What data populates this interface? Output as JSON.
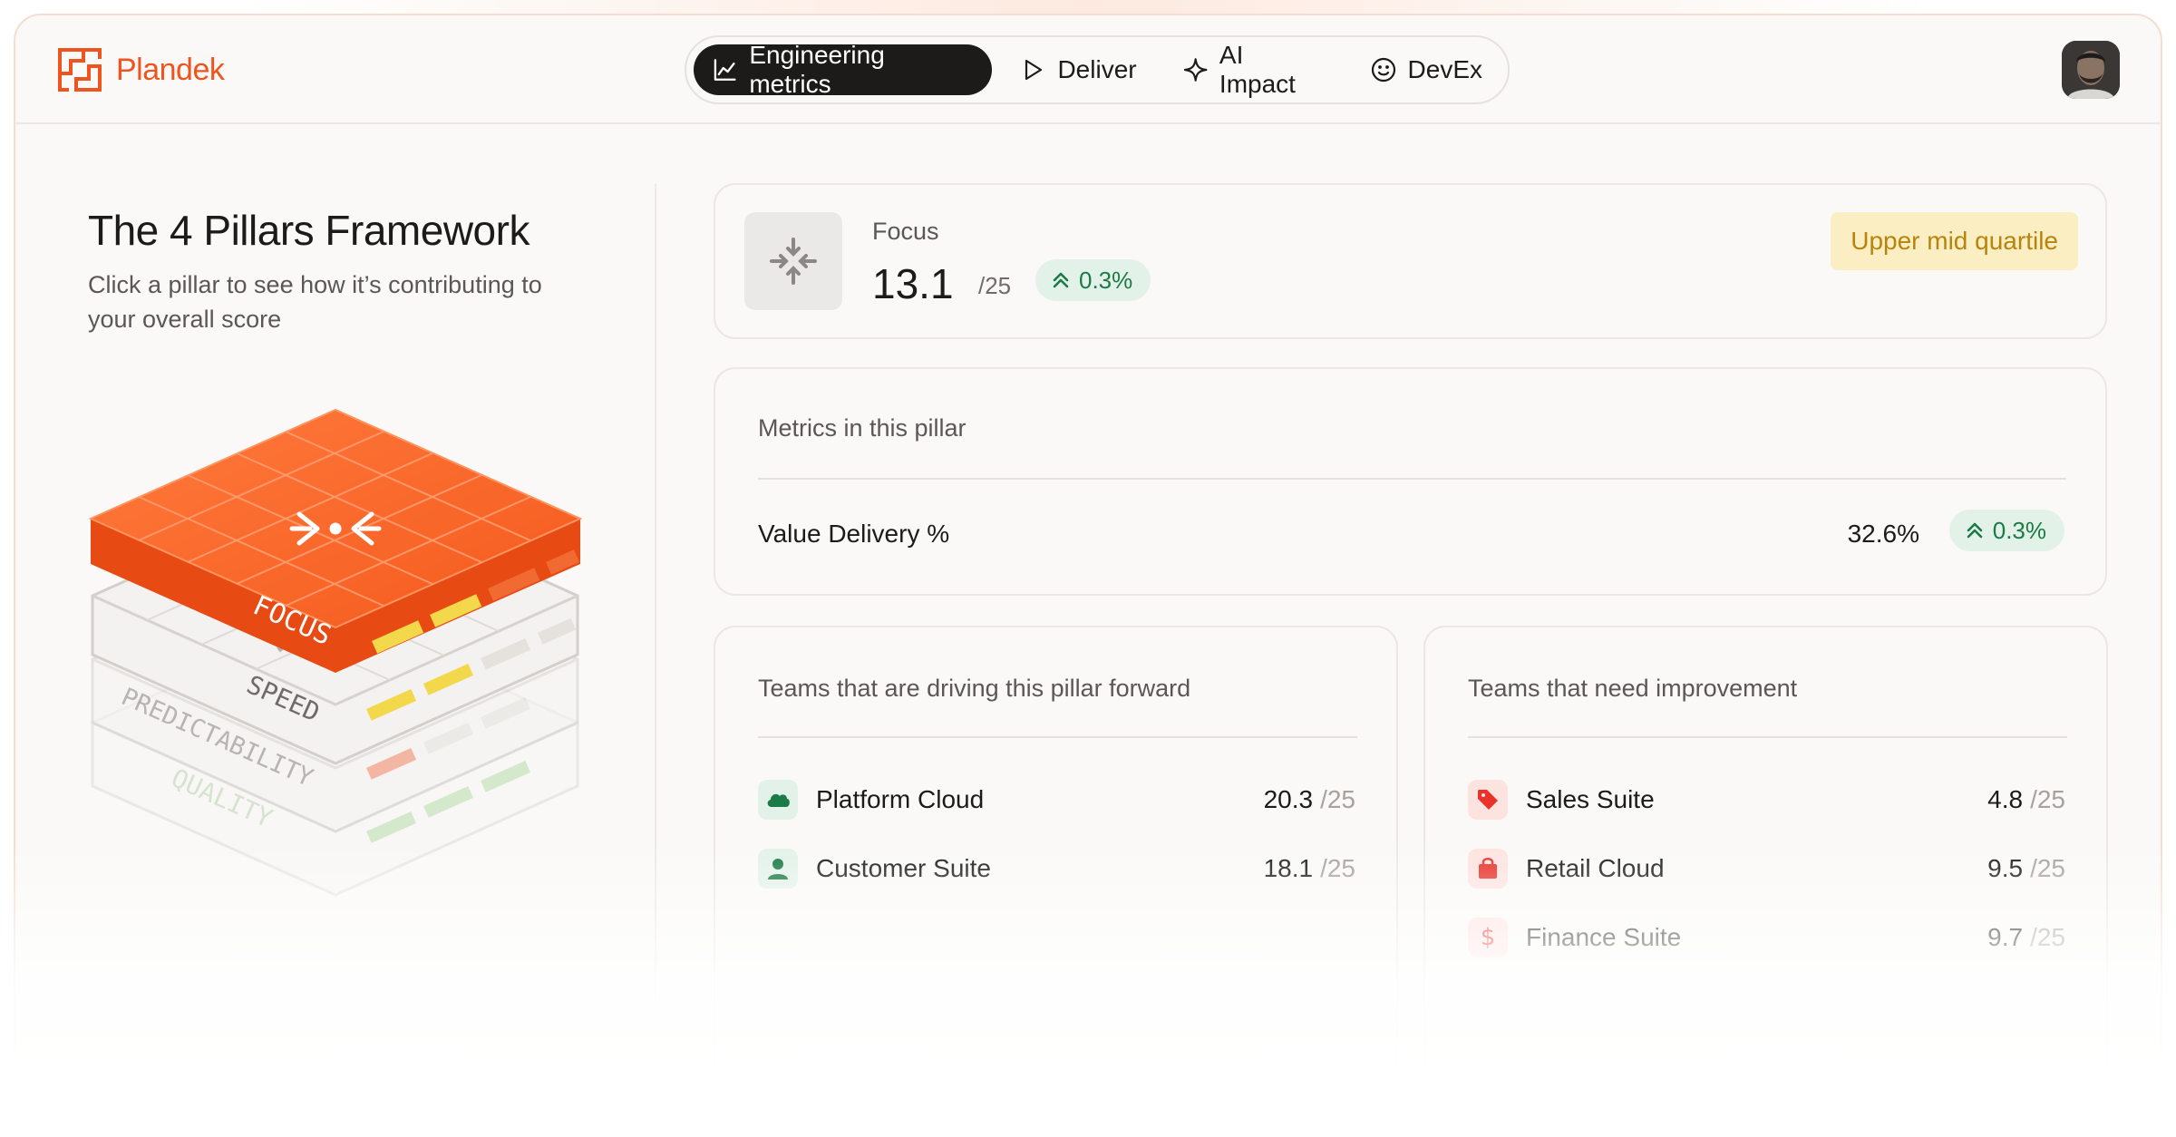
{
  "brand": {
    "name": "Plandek",
    "accent": "#f0541e"
  },
  "nav": {
    "items": [
      {
        "label": "Engineering metrics",
        "icon": "line-chart-icon",
        "active": true
      },
      {
        "label": "Deliver",
        "icon": "play-icon",
        "active": false
      },
      {
        "label": "AI Impact",
        "icon": "sparkle-icon",
        "active": false
      },
      {
        "label": "DevEx",
        "icon": "smiley-icon",
        "active": false
      }
    ]
  },
  "intro": {
    "title": "The 4 Pillars Framework",
    "subtitle": "Click a pillar to see how it’s contributing to your overall score"
  },
  "pillars": [
    "FOCUS",
    "SPEED",
    "PREDICTABILITY",
    "QUALITY"
  ],
  "focus": {
    "label": "Focus",
    "score": "13.1",
    "denom": "/25",
    "change": "0.3%",
    "quartile": "Upper mid quartile"
  },
  "metrics": {
    "heading": "Metrics in this pillar",
    "items": [
      {
        "name": "Value Delivery %",
        "value": "32.6%",
        "change": "0.3%"
      }
    ]
  },
  "teams_forward": {
    "heading": "Teams that are driving this pillar forward",
    "items": [
      {
        "name": "Platform Cloud",
        "score": "20.3",
        "denom": "/25",
        "icon": "cloud-icon"
      },
      {
        "name": "Customer Suite",
        "score": "18.1",
        "denom": "/25",
        "icon": "user-icon"
      }
    ]
  },
  "teams_improve": {
    "heading": "Teams that need improvement",
    "items": [
      {
        "name": "Sales Suite",
        "score": "4.8",
        "denom": "/25",
        "icon": "tag-icon"
      },
      {
        "name": "Retail Cloud",
        "score": "9.5",
        "denom": "/25",
        "icon": "shopping-bag-icon"
      },
      {
        "name": "Finance Suite",
        "score": "9.7",
        "denom": "/25",
        "icon": "dollar-icon"
      }
    ]
  },
  "colors": {
    "positive_bg": "#e3f2e8",
    "positive_text": "#1b7a45",
    "quartile_bg": "#fbeec3",
    "quartile_text": "#b7840d",
    "green_icon_bg": "#e3f2e8",
    "red_icon_bg": "#fde3e0"
  }
}
